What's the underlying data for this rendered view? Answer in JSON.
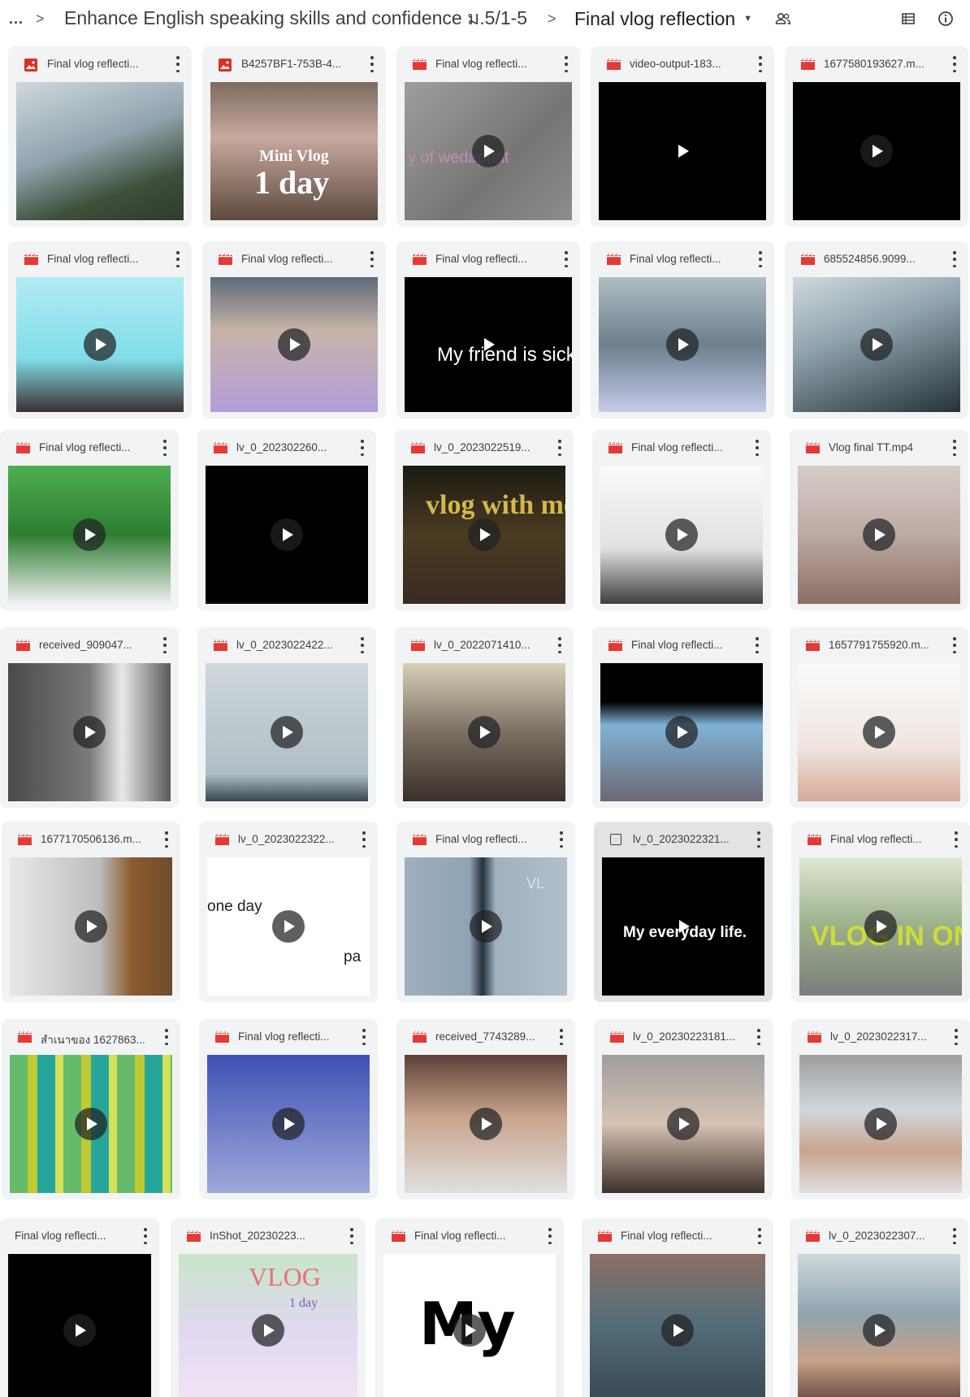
{
  "breadcrumb": {
    "overflow_label": "...",
    "separator": ">",
    "parent": "Enhance English speaking skills and confidence ม.5/1-5",
    "current": "Final vlog reflection"
  },
  "header_icons": [
    "more-horiz-icon",
    "chevron-right-icon",
    "dropdown-caret-icon",
    "shared-people-icon",
    "list-view-icon",
    "info-icon"
  ],
  "colors": {
    "video_red": "#e53935",
    "image_red": "#d93025",
    "card_bg": "#f1f3f4"
  },
  "files": [
    {
      "name": "Final vlog reflecti...",
      "type": "image"
    },
    {
      "name": "B4257BF1-753B-4...",
      "type": "image",
      "overlay": [
        "Mini Vlog",
        "1 day"
      ]
    },
    {
      "name": "Final vlog reflecti...",
      "type": "video",
      "overlay": [
        "y of  wedaphat"
      ]
    },
    {
      "name": "video-output-183...",
      "type": "video"
    },
    {
      "name": "1677580193627.m...",
      "type": "video"
    },
    {
      "name": "Final vlog reflecti...",
      "type": "video"
    },
    {
      "name": "Final vlog reflecti...",
      "type": "video"
    },
    {
      "name": "Final vlog reflecti...",
      "type": "video",
      "overlay": [
        "My friend is sick."
      ]
    },
    {
      "name": "Final vlog reflecti...",
      "type": "video"
    },
    {
      "name": "685524856.9099...",
      "type": "video"
    },
    {
      "name": "Final vlog reflecti...",
      "type": "video"
    },
    {
      "name": "lv_0_202302260...",
      "type": "video"
    },
    {
      "name": "lv_0_2023022519...",
      "type": "video",
      "overlay": [
        "vlog with me."
      ]
    },
    {
      "name": "Final vlog reflecti...",
      "type": "video"
    },
    {
      "name": "Vlog final TT.mp4",
      "type": "video"
    },
    {
      "name": "received_909047...",
      "type": "video"
    },
    {
      "name": "lv_0_2023022422...",
      "type": "video"
    },
    {
      "name": "lv_0_2022071410...",
      "type": "video"
    },
    {
      "name": "Final vlog reflecti...",
      "type": "video"
    },
    {
      "name": "1657791755920.m...",
      "type": "video"
    },
    {
      "name": "1677170506136.m...",
      "type": "video"
    },
    {
      "name": "lv_0_2023022322...",
      "type": "video",
      "overlay": [
        "one day",
        "pa"
      ]
    },
    {
      "name": "Final vlog reflecti...",
      "type": "video",
      "overlay": [
        "VL"
      ]
    },
    {
      "name": "lv_0_2023022321...",
      "type": "video",
      "selected": true,
      "overlay": [
        "My everyday life."
      ]
    },
    {
      "name": "Final vlog reflecti...",
      "type": "video",
      "overlay": [
        "VLOG IN ONE"
      ]
    },
    {
      "name": "สำเนาของ 1627863...",
      "type": "video"
    },
    {
      "name": "Final vlog reflecti...",
      "type": "video"
    },
    {
      "name": "received_7743289...",
      "type": "video"
    },
    {
      "name": "lv_0_20230223181...",
      "type": "video"
    },
    {
      "name": "lv_0_2023022317...",
      "type": "video"
    },
    {
      "name": "Final vlog reflecti...",
      "type": "video",
      "no_icon": true
    },
    {
      "name": "InShot_20230223...",
      "type": "video",
      "overlay": [
        "VLOG",
        "1 day"
      ]
    },
    {
      "name": "Final vlog reflecti...",
      "type": "video",
      "overlay": [
        "My"
      ]
    },
    {
      "name": "Final vlog reflecti...",
      "type": "video"
    },
    {
      "name": "lv_0_2023022307...",
      "type": "video"
    }
  ]
}
